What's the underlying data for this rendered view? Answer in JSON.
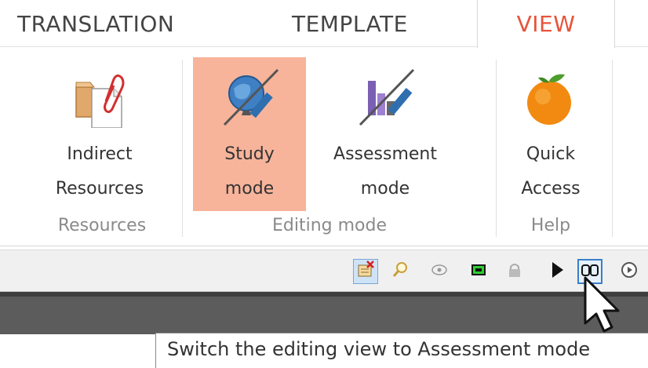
{
  "tabs": [
    {
      "label": "TRANSLATION"
    },
    {
      "label": "TEMPLATE"
    },
    {
      "label": "VIEW",
      "active": true
    }
  ],
  "ribbon": {
    "buttons": [
      {
        "line1": "Indirect",
        "line2": "Resources",
        "icon": "folder-paperclip-icon"
      },
      {
        "line1": "Study",
        "line2": "mode",
        "icon": "study-mode-icon",
        "selected": true
      },
      {
        "line1": "Assessment",
        "line2": "mode",
        "icon": "assessment-mode-icon"
      },
      {
        "line1": "Quick",
        "line2": "Access",
        "icon": "orange-fruit-icon"
      }
    ],
    "groups": [
      {
        "label": "Resources"
      },
      {
        "label": "Editing mode"
      },
      {
        "label": "Help"
      }
    ]
  },
  "toolbar": {
    "icons": [
      "tag-close-icon",
      "magnifier-icon",
      "eye-icon",
      "green-frame-icon",
      "lock-icon",
      "play-icon",
      "assessment-binoculars-icon",
      "clock-play-icon"
    ]
  },
  "tooltip": {
    "text": "Switch the editing view to Assessment mode"
  },
  "colors": {
    "accent": "#e8533a",
    "selected_bg": "#f7b49b",
    "toolbar_bg": "#f0f0f0",
    "work_bg": "#5c5c5c"
  }
}
